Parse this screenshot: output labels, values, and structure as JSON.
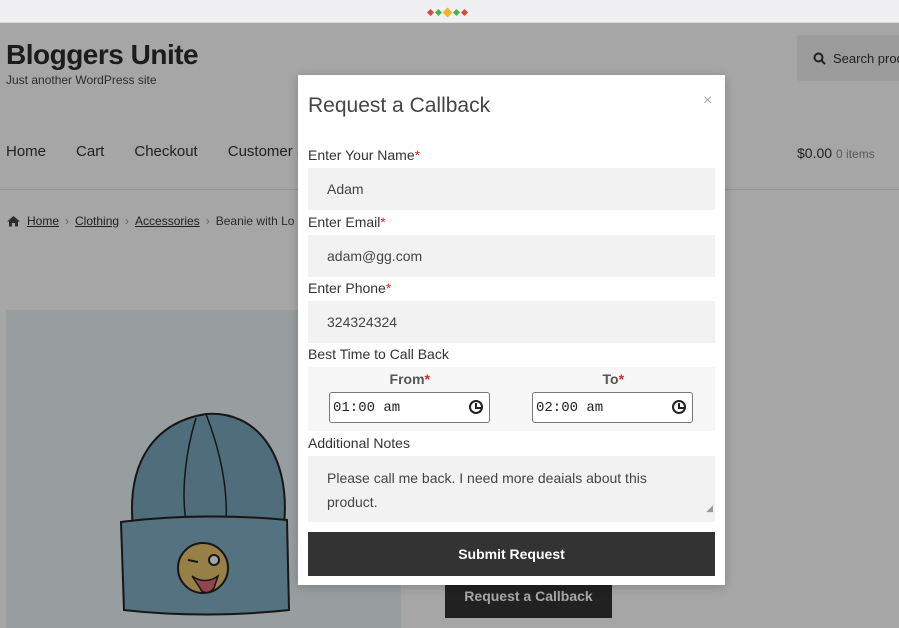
{
  "colors": {
    "accent": "#333333",
    "required": "#e02424",
    "dots": [
      "#e0453a",
      "#4caf50",
      "#f0b429",
      "#4caf50",
      "#e0453a"
    ]
  },
  "site": {
    "title": "Bloggers Unite",
    "tagline": "Just another WordPress site"
  },
  "search": {
    "icon": "search-icon",
    "placeholder": "Search prod"
  },
  "nav": {
    "items": [
      "Home",
      "Cart",
      "Checkout",
      "Customer S"
    ]
  },
  "cart": {
    "amount": "$0.00",
    "items": "0 items"
  },
  "breadcrumb": {
    "icon": "home-icon",
    "items": [
      "Home",
      "Clothing",
      "Accessories"
    ],
    "current": "Beanie with Lo",
    "separator": "›"
  },
  "product": {
    "button": "Request a Callback"
  },
  "modal": {
    "title": "Request a Callback",
    "close": "×",
    "name_label": "Enter Your Name",
    "name_value": "Adam",
    "email_label": "Enter Email",
    "email_value": "adam@gg.com",
    "phone_label": "Enter Phone",
    "phone_value": "324324324",
    "best_time_label": "Best Time to Call Back",
    "from_label": "From",
    "to_label": "To",
    "from_value": "01:00 am",
    "to_value": "02:00 am",
    "notes_label": "Additional Notes",
    "notes_value": "Please call me back. I need more deaials about this product.",
    "required_mark": "*",
    "submit": "Submit Request"
  }
}
